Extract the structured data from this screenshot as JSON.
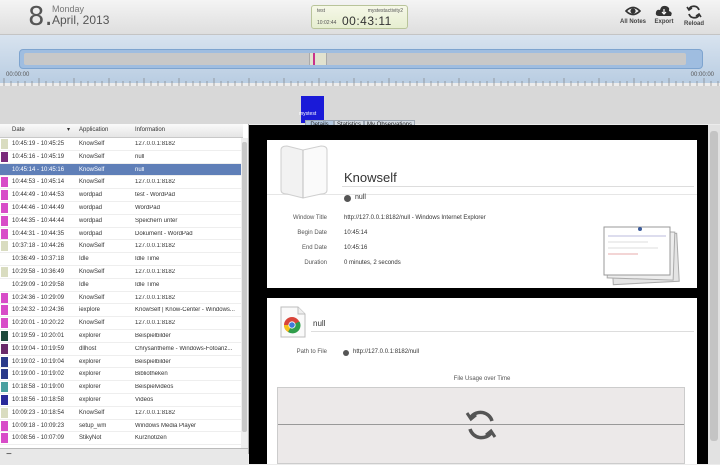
{
  "header": {
    "day_number": "8.",
    "weekday": "Monday",
    "month_year": "April, 2013",
    "timer": {
      "label": "test",
      "activity": "mystestactivity2",
      "clock": "10:02:44",
      "elapsed": "00:43:11"
    },
    "buttons": {
      "all_notes": "All Notes",
      "export": "Export",
      "reload": "Reload"
    }
  },
  "timeline": {
    "start_label": "00:00:00",
    "end_label": "00:00:00",
    "activity_tooltip": "mystest"
  },
  "tabs": [
    "Details",
    "Statistics",
    "My Observations"
  ],
  "list": {
    "columns": [
      "Date",
      "Application",
      "Information"
    ],
    "rows": [
      {
        "date": "10:45:19 - 10:45:25",
        "app": "KnowSelf",
        "info": "127.0.0.1:8182",
        "color": "#d9dcc0"
      },
      {
        "date": "10:45:16 - 10:45:19",
        "app": "KnowSelf",
        "info": "null",
        "color": "#7a2a7a"
      },
      {
        "date": "10:45:14 - 10:45:16",
        "app": "KnowSelf",
        "info": "null",
        "color": "#5f7fb8"
      },
      {
        "date": "10:44:53 - 10:45:14",
        "app": "KnowSelf",
        "info": "127.0.0.1:8182",
        "color": "#d84cc8"
      },
      {
        "date": "10:44:49 - 10:44:53",
        "app": "wordpad",
        "info": "test - WordPad",
        "color": "#d84cc8"
      },
      {
        "date": "10:44:46 - 10:44:49",
        "app": "wordpad",
        "info": "WordPad",
        "color": "#d84cc8"
      },
      {
        "date": "10:44:35 - 10:44:44",
        "app": "wordpad",
        "info": "Speichern unter",
        "color": "#d84cc8"
      },
      {
        "date": "10:44:31 - 10:44:35",
        "app": "wordpad",
        "info": "Dokument - WordPad",
        "color": "#d84cc8"
      },
      {
        "date": "10:37:18 - 10:44:26",
        "app": "KnowSelf",
        "info": "127.0.0.1:8182",
        "color": "#d9dcc0"
      },
      {
        "date": "10:36:49 - 10:37:18",
        "app": "Idle",
        "info": "Idle Time",
        "color": "#ffffff"
      },
      {
        "date": "10:29:58 - 10:36:49",
        "app": "KnowSelf",
        "info": "127.0.0.1:8182",
        "color": "#d9dcc0"
      },
      {
        "date": "10:29:09 - 10:29:58",
        "app": "Idle",
        "info": "Idle Time",
        "color": "#ffffff"
      },
      {
        "date": "10:24:36 - 10:29:09",
        "app": "KnowSelf",
        "info": "127.0.0.1:8182",
        "color": "#d84cc8"
      },
      {
        "date": "10:24:32 - 10:24:36",
        "app": "iexplore",
        "info": "KnowSelf | Know-Center - Windows...",
        "color": "#d84cc8"
      },
      {
        "date": "10:20:01 - 10:20:22",
        "app": "KnowSelf",
        "info": "127.0.0.1:8182",
        "color": "#d84cc8"
      },
      {
        "date": "10:19:59 - 10:20:01",
        "app": "explorer",
        "info": "Beispielbilder",
        "color": "#1e4a3c"
      },
      {
        "date": "10:19:04 - 10:19:59",
        "app": "dllhost",
        "info": "Chrysantheme - Windows-Fotoanz...",
        "color": "#6a2a6a"
      },
      {
        "date": "10:19:02 - 10:19:04",
        "app": "explorer",
        "info": "Beispielbilder",
        "color": "#2a3a8a"
      },
      {
        "date": "10:19:00 - 10:19:02",
        "app": "explorer",
        "info": "Bibliotheken",
        "color": "#2a3a8a"
      },
      {
        "date": "10:18:58 - 10:19:00",
        "app": "explorer",
        "info": "Beispielvideos",
        "color": "#4aa0a0"
      },
      {
        "date": "10:18:56 - 10:18:58",
        "app": "explorer",
        "info": "Videos",
        "color": "#2a2a9a"
      },
      {
        "date": "10:09:23 - 10:18:54",
        "app": "KnowSelf",
        "info": "127.0.0.1:8182",
        "color": "#d9dcc0"
      },
      {
        "date": "10:09:18 - 10:09:23",
        "app": "setup_wm",
        "info": "Windows Media Player",
        "color": "#d84cc8"
      },
      {
        "date": "10:08:56 - 10:07:09",
        "app": "StikyNot",
        "info": "Kurznotizen",
        "color": "#d84cc8"
      }
    ],
    "selected_index": 2,
    "minus_label": "−"
  },
  "details": {
    "app_name": "Knowself",
    "subtitle": "null",
    "fields": [
      {
        "label": "Window Title",
        "value": "http://127.0.0.1:8182/null - Windows Internet Explorer"
      },
      {
        "label": "Begin Date",
        "value": "10:45:14"
      },
      {
        "label": "End Date",
        "value": "10:45:16"
      },
      {
        "label": "Duration",
        "value": "0 minutes, 2 seconds"
      }
    ],
    "file": {
      "name": "null",
      "path_label": "Path to File",
      "path_value": "http://127.0.0.1:8182/null",
      "usage_title": "File Usage over Time"
    }
  }
}
